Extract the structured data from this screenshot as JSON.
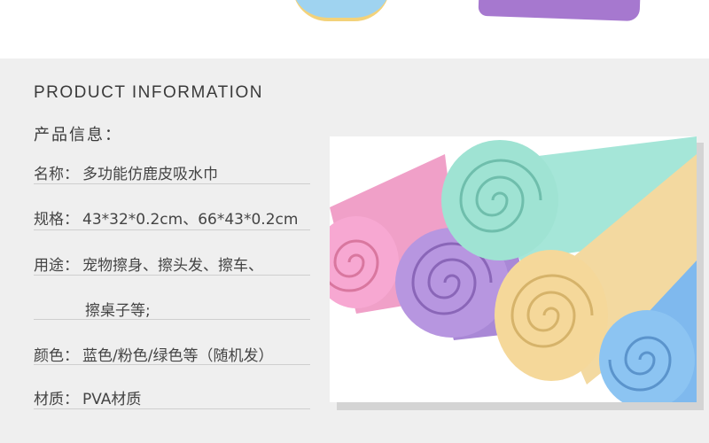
{
  "header": {
    "section_title": "PRODUCT INFORMATION",
    "sub_title": "产品信息："
  },
  "info": [
    {
      "label": "名称：",
      "value": "多功能仿鹿皮吸水巾"
    },
    {
      "label": "规格：",
      "value": "43*32*0.2cm、66*43*0.2cm"
    },
    {
      "label": "用途：",
      "value": "宠物擦身、擦头发、擦车、"
    },
    {
      "label": "",
      "value": "擦桌子等;"
    },
    {
      "label": "颜色：",
      "value": "蓝色/粉色/绿色等（随机发）"
    },
    {
      "label": "材质：",
      "value": "PVA材质"
    }
  ],
  "photo": {
    "subject": "rolled towels",
    "colors": [
      "#f7a8d2",
      "#b796e0",
      "#9fe3d3",
      "#f5d89a",
      "#8cc4f2"
    ]
  }
}
